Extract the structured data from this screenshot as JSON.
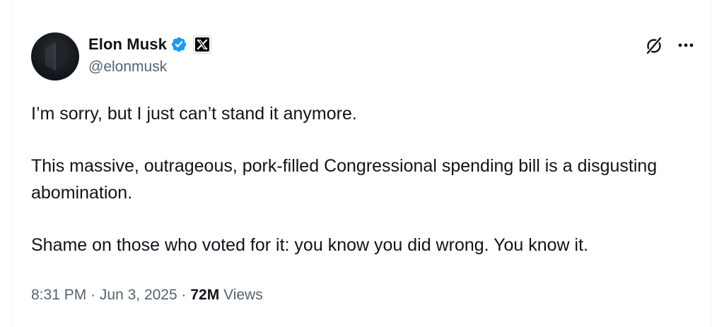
{
  "author": {
    "display_name": "Elon Musk",
    "handle": "@elonmusk",
    "verified": true,
    "affiliate": "X",
    "badge_color": "#1d9bf0"
  },
  "tweet": {
    "paragraphs": [
      "I’m sorry, but I just can’t stand it anymore.",
      "This massive, outrageous, pork-filled Congressional spending bill is a disgusting abomination.",
      "Shame on those who voted for it: you know you did wrong. You know it."
    ]
  },
  "meta": {
    "time": "8:31 PM",
    "separator": "·",
    "date": "Jun 3, 2025",
    "views_count": "72M",
    "views_label": "Views"
  },
  "icons": {
    "grok": "grok-icon",
    "more": "more-options-icon",
    "verified": "verified-badge-icon",
    "affiliate": "x-logo-icon"
  }
}
